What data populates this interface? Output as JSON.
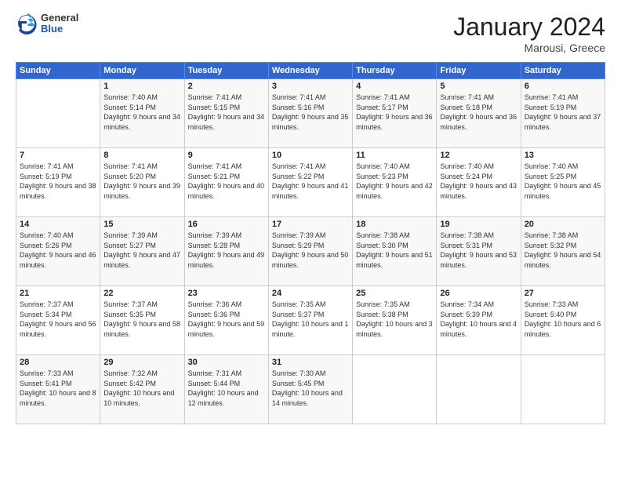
{
  "logo": {
    "line1": "General",
    "line2": "Blue"
  },
  "title": "January 2024",
  "location": "Marousi, Greece",
  "days_header": [
    "Sunday",
    "Monday",
    "Tuesday",
    "Wednesday",
    "Thursday",
    "Friday",
    "Saturday"
  ],
  "weeks": [
    [
      {
        "day": "",
        "sunrise": "",
        "sunset": "",
        "daylight": ""
      },
      {
        "day": "1",
        "sunrise": "Sunrise: 7:40 AM",
        "sunset": "Sunset: 5:14 PM",
        "daylight": "Daylight: 9 hours and 34 minutes."
      },
      {
        "day": "2",
        "sunrise": "Sunrise: 7:41 AM",
        "sunset": "Sunset: 5:15 PM",
        "daylight": "Daylight: 9 hours and 34 minutes."
      },
      {
        "day": "3",
        "sunrise": "Sunrise: 7:41 AM",
        "sunset": "Sunset: 5:16 PM",
        "daylight": "Daylight: 9 hours and 35 minutes."
      },
      {
        "day": "4",
        "sunrise": "Sunrise: 7:41 AM",
        "sunset": "Sunset: 5:17 PM",
        "daylight": "Daylight: 9 hours and 36 minutes."
      },
      {
        "day": "5",
        "sunrise": "Sunrise: 7:41 AM",
        "sunset": "Sunset: 5:18 PM",
        "daylight": "Daylight: 9 hours and 36 minutes."
      },
      {
        "day": "6",
        "sunrise": "Sunrise: 7:41 AM",
        "sunset": "Sunset: 5:19 PM",
        "daylight": "Daylight: 9 hours and 37 minutes."
      }
    ],
    [
      {
        "day": "7",
        "sunrise": "Sunrise: 7:41 AM",
        "sunset": "Sunset: 5:19 PM",
        "daylight": "Daylight: 9 hours and 38 minutes."
      },
      {
        "day": "8",
        "sunrise": "Sunrise: 7:41 AM",
        "sunset": "Sunset: 5:20 PM",
        "daylight": "Daylight: 9 hours and 39 minutes."
      },
      {
        "day": "9",
        "sunrise": "Sunrise: 7:41 AM",
        "sunset": "Sunset: 5:21 PM",
        "daylight": "Daylight: 9 hours and 40 minutes."
      },
      {
        "day": "10",
        "sunrise": "Sunrise: 7:41 AM",
        "sunset": "Sunset: 5:22 PM",
        "daylight": "Daylight: 9 hours and 41 minutes."
      },
      {
        "day": "11",
        "sunrise": "Sunrise: 7:40 AM",
        "sunset": "Sunset: 5:23 PM",
        "daylight": "Daylight: 9 hours and 42 minutes."
      },
      {
        "day": "12",
        "sunrise": "Sunrise: 7:40 AM",
        "sunset": "Sunset: 5:24 PM",
        "daylight": "Daylight: 9 hours and 43 minutes."
      },
      {
        "day": "13",
        "sunrise": "Sunrise: 7:40 AM",
        "sunset": "Sunset: 5:25 PM",
        "daylight": "Daylight: 9 hours and 45 minutes."
      }
    ],
    [
      {
        "day": "14",
        "sunrise": "Sunrise: 7:40 AM",
        "sunset": "Sunset: 5:26 PM",
        "daylight": "Daylight: 9 hours and 46 minutes."
      },
      {
        "day": "15",
        "sunrise": "Sunrise: 7:39 AM",
        "sunset": "Sunset: 5:27 PM",
        "daylight": "Daylight: 9 hours and 47 minutes."
      },
      {
        "day": "16",
        "sunrise": "Sunrise: 7:39 AM",
        "sunset": "Sunset: 5:28 PM",
        "daylight": "Daylight: 9 hours and 49 minutes."
      },
      {
        "day": "17",
        "sunrise": "Sunrise: 7:39 AM",
        "sunset": "Sunset: 5:29 PM",
        "daylight": "Daylight: 9 hours and 50 minutes."
      },
      {
        "day": "18",
        "sunrise": "Sunrise: 7:38 AM",
        "sunset": "Sunset: 5:30 PM",
        "daylight": "Daylight: 9 hours and 51 minutes."
      },
      {
        "day": "19",
        "sunrise": "Sunrise: 7:38 AM",
        "sunset": "Sunset: 5:31 PM",
        "daylight": "Daylight: 9 hours and 53 minutes."
      },
      {
        "day": "20",
        "sunrise": "Sunrise: 7:38 AM",
        "sunset": "Sunset: 5:32 PM",
        "daylight": "Daylight: 9 hours and 54 minutes."
      }
    ],
    [
      {
        "day": "21",
        "sunrise": "Sunrise: 7:37 AM",
        "sunset": "Sunset: 5:34 PM",
        "daylight": "Daylight: 9 hours and 56 minutes."
      },
      {
        "day": "22",
        "sunrise": "Sunrise: 7:37 AM",
        "sunset": "Sunset: 5:35 PM",
        "daylight": "Daylight: 9 hours and 58 minutes."
      },
      {
        "day": "23",
        "sunrise": "Sunrise: 7:36 AM",
        "sunset": "Sunset: 5:36 PM",
        "daylight": "Daylight: 9 hours and 59 minutes."
      },
      {
        "day": "24",
        "sunrise": "Sunrise: 7:35 AM",
        "sunset": "Sunset: 5:37 PM",
        "daylight": "Daylight: 10 hours and 1 minute."
      },
      {
        "day": "25",
        "sunrise": "Sunrise: 7:35 AM",
        "sunset": "Sunset: 5:38 PM",
        "daylight": "Daylight: 10 hours and 3 minutes."
      },
      {
        "day": "26",
        "sunrise": "Sunrise: 7:34 AM",
        "sunset": "Sunset: 5:39 PM",
        "daylight": "Daylight: 10 hours and 4 minutes."
      },
      {
        "day": "27",
        "sunrise": "Sunrise: 7:33 AM",
        "sunset": "Sunset: 5:40 PM",
        "daylight": "Daylight: 10 hours and 6 minutes."
      }
    ],
    [
      {
        "day": "28",
        "sunrise": "Sunrise: 7:33 AM",
        "sunset": "Sunset: 5:41 PM",
        "daylight": "Daylight: 10 hours and 8 minutes."
      },
      {
        "day": "29",
        "sunrise": "Sunrise: 7:32 AM",
        "sunset": "Sunset: 5:42 PM",
        "daylight": "Daylight: 10 hours and 10 minutes."
      },
      {
        "day": "30",
        "sunrise": "Sunrise: 7:31 AM",
        "sunset": "Sunset: 5:44 PM",
        "daylight": "Daylight: 10 hours and 12 minutes."
      },
      {
        "day": "31",
        "sunrise": "Sunrise: 7:30 AM",
        "sunset": "Sunset: 5:45 PM",
        "daylight": "Daylight: 10 hours and 14 minutes."
      },
      {
        "day": "",
        "sunrise": "",
        "sunset": "",
        "daylight": ""
      },
      {
        "day": "",
        "sunrise": "",
        "sunset": "",
        "daylight": ""
      },
      {
        "day": "",
        "sunrise": "",
        "sunset": "",
        "daylight": ""
      }
    ]
  ]
}
